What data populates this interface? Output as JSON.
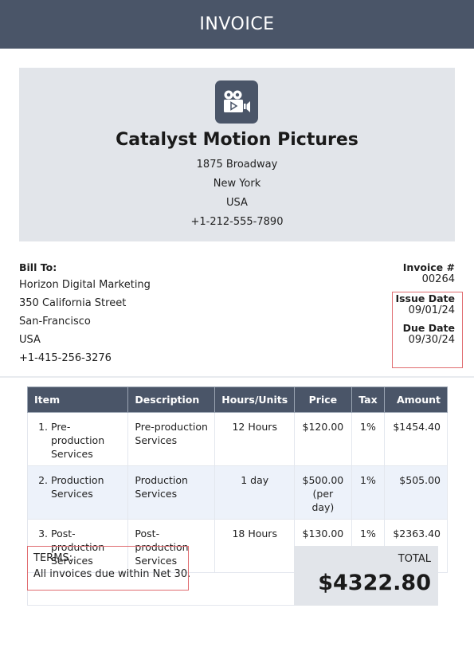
{
  "header": {
    "title": "INVOICE"
  },
  "company": {
    "logo_icon": "video-camera-icon",
    "name": "Catalyst Motion Pictures",
    "address_lines": [
      "1875 Broadway",
      "New York",
      "USA",
      "+1-212-555-7890"
    ]
  },
  "bill_to": {
    "label": "Bill To:",
    "lines": [
      "Horizon Digital Marketing",
      "350 California Street",
      "San-Francisco",
      "USA",
      "+1-415-256-3276"
    ]
  },
  "invoice_meta": {
    "number_label": "Invoice #",
    "number": "00264",
    "issue_date_label": "Issue Date",
    "issue_date": "09/01/24",
    "due_date_label": "Due Date",
    "due_date": "09/30/24"
  },
  "table": {
    "headers": [
      "Item",
      "Description",
      "Hours/Units",
      "Price",
      "Tax",
      "Amount"
    ],
    "rows": [
      {
        "num": "1.",
        "item": "Pre-production Services",
        "description": "Pre-production Services",
        "units": "12 Hours",
        "price": "$120.00",
        "price_note": "",
        "tax": "1%",
        "amount": "$1454.40"
      },
      {
        "num": "2.",
        "item": "Production Services",
        "description": "Production Services",
        "units": "1 day",
        "price": "$500.00",
        "price_note": "(per day)",
        "tax": "1%",
        "amount": "$505.00"
      },
      {
        "num": "3.",
        "item": "Post-production Services",
        "description": "Post-production Services",
        "units": "18 Hours",
        "price": "$130.00",
        "price_note": "",
        "tax": "1%",
        "amount": "$2363.40"
      }
    ]
  },
  "terms": {
    "label": "TERMS:",
    "text": "All invoices due within Net 30."
  },
  "total": {
    "label": "TOTAL",
    "value": "$4322.80"
  },
  "colors": {
    "header_bg": "#4a5568",
    "panel_bg": "#e2e5ea",
    "highlight": "#e06c70",
    "alt_row": "#edf2fa"
  }
}
